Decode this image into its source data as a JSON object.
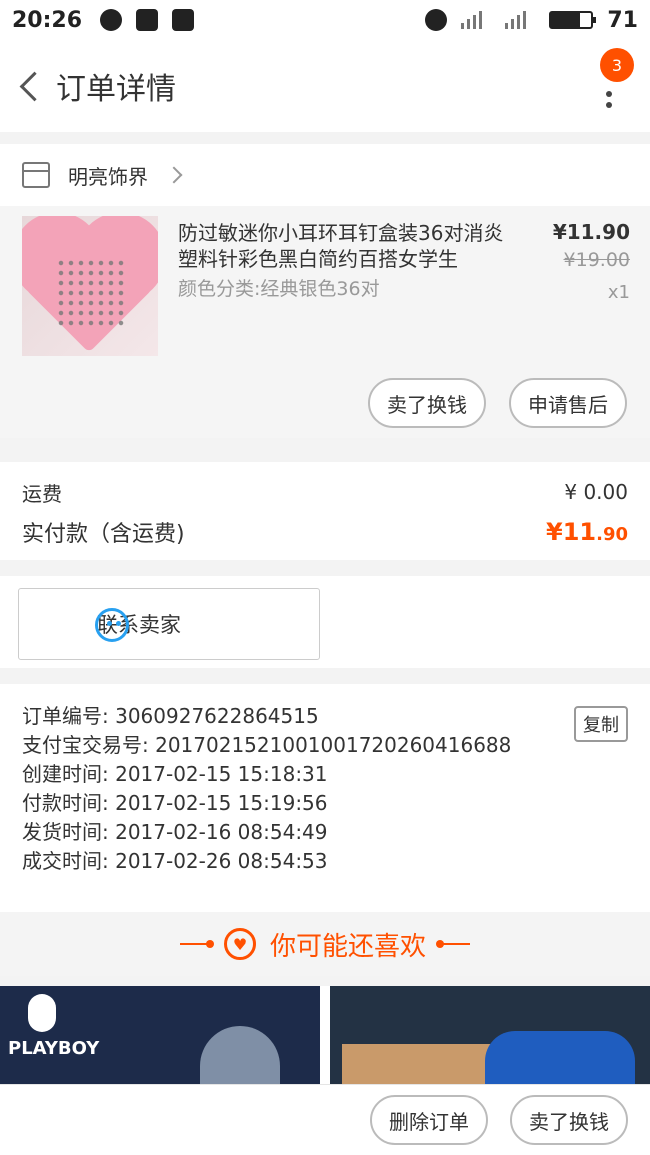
{
  "status": {
    "time": "20:26",
    "battery": "71",
    "battery_level": 0.71,
    "icons": [
      "qq-icon",
      "message-icon",
      "shield-icon",
      "alarm-icon",
      "signal-icon",
      "signal-4g-icon",
      "battery-icon"
    ]
  },
  "nav": {
    "title": "订单详情",
    "badge": "3"
  },
  "shop": {
    "name": "明亮饰界"
  },
  "product": {
    "title": "防过敏迷你小耳环耳钉盒装36对消炎塑料针彩色黑白简约百搭女学生",
    "sku": "颜色分类:经典银色36对",
    "price_now": "¥11.90",
    "price_old": "¥19.00",
    "qty": "x1",
    "btn_sell": "卖了换钱",
    "btn_after": "申请售后"
  },
  "fees": {
    "shipping_label": "运费",
    "shipping_value": "¥ 0.00",
    "paid_label": "实付款（含运费)",
    "paid_main": "¥11",
    "paid_small": ".90"
  },
  "contact": {
    "label": "联系卖家"
  },
  "order_info": {
    "copy": "复制",
    "lines": [
      "订单编号: 3060927622864515",
      "支付宝交易号: 2017021521001001720260416688",
      "创建时间: 2017-02-15 15:18:31",
      "付款时间: 2017-02-15 15:19:56",
      "发货时间: 2017-02-16 08:54:49",
      "成交时间: 2017-02-26 08:54:53"
    ]
  },
  "recommend": {
    "title": "你可能还喜欢",
    "brand": "PLAYBOY"
  },
  "bottom": {
    "delete": "删除订单",
    "sell": "卖了换钱"
  }
}
